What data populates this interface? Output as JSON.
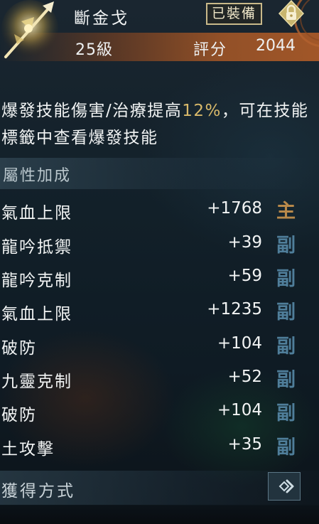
{
  "item": {
    "name": "斷金戈",
    "level": "25級",
    "equipped_badge": "已裝備",
    "score_label": "評分",
    "score_value": "2044"
  },
  "description": {
    "part1": "爆發技能傷害/治療提高",
    "highlight": "12%",
    "part2": "，可在技能標籤中查看爆發技能"
  },
  "attributes": {
    "header": "屬性加成",
    "rows": [
      {
        "label": "氣血上限",
        "value": "+1768",
        "tag": "主"
      },
      {
        "label": "龍吟抵禦",
        "value": "+39",
        "tag": "副"
      },
      {
        "label": "龍吟克制",
        "value": "+59",
        "tag": "副"
      },
      {
        "label": "氣血上限",
        "value": "+1235",
        "tag": "副"
      },
      {
        "label": "破防",
        "value": "+104",
        "tag": "副"
      },
      {
        "label": "九靈克制",
        "value": "+52",
        "tag": "副"
      },
      {
        "label": "破防",
        "value": "+104",
        "tag": "副"
      },
      {
        "label": "土攻擊",
        "value": "+35",
        "tag": "副"
      }
    ]
  },
  "obtain": {
    "label": "獲得方式"
  },
  "icons": {
    "weapon": "halberd-weapon-icon",
    "lock": "lock-icon",
    "obtain_arrow": "chevron-right-icon"
  },
  "colors": {
    "highlight": "#d8b96a",
    "main_tag": "#b8894a",
    "sub_tag": "#4f7e9a",
    "level_bar": "#b05c28"
  }
}
